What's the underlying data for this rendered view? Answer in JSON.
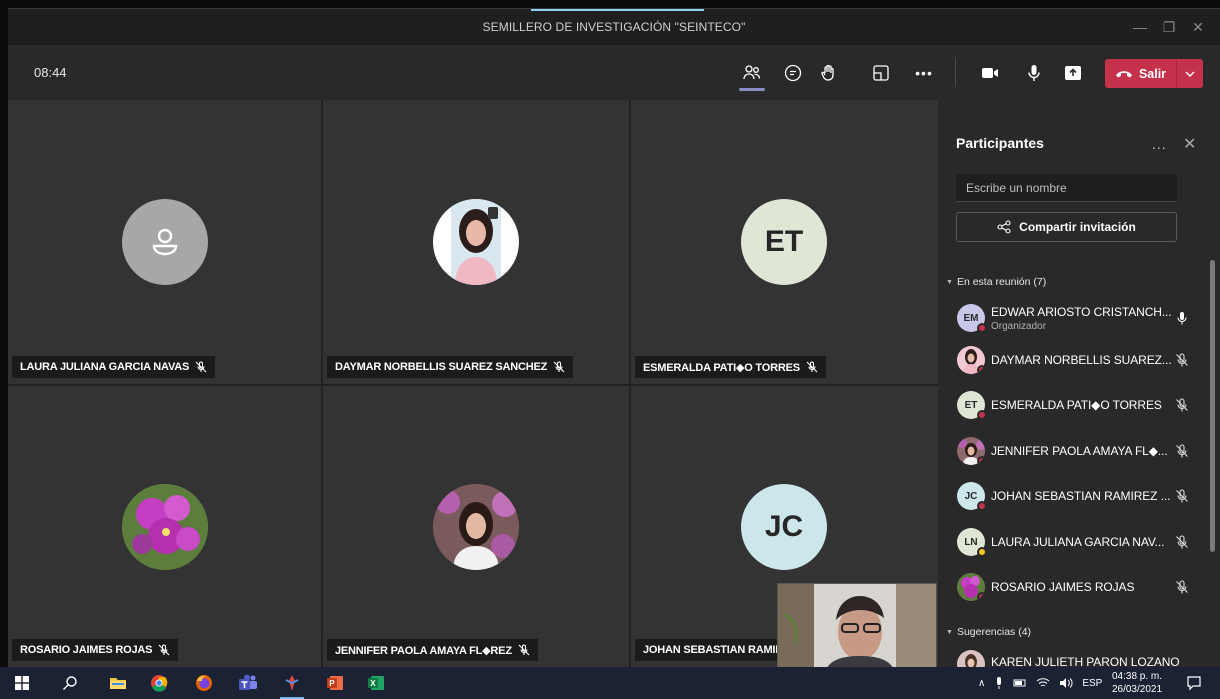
{
  "window": {
    "title": "SEMILLERO DE INVESTIGACIÓN \"SEINTECO\"",
    "minimize": "—",
    "maximize": "❐",
    "close": "✕"
  },
  "toolbar": {
    "timer": "08:44",
    "leave_label": "Salir"
  },
  "tiles": [
    {
      "name": "LAURA JULIANA GARCIA NAVAS",
      "avatar_type": "generic-person-icon",
      "avatar_color": "#a7a7a7"
    },
    {
      "name": "DAYMAR NORBELLIS SUAREZ SANCHEZ",
      "avatar_type": "photo",
      "avatar_color": "#f2d6dc"
    },
    {
      "name": "ESMERALDA PATI◆O TORRES",
      "avatar_type": "initials",
      "initials": "ET",
      "avatar_color": "#dfe6d5"
    },
    {
      "name": "ROSARIO JAIMES ROJAS",
      "avatar_type": "photo",
      "avatar_color": "#b23fb8"
    },
    {
      "name": "JENNIFER PAOLA AMAYA FL◆REZ",
      "avatar_type": "photo",
      "avatar_color": "#8c6a6d"
    },
    {
      "name": "JOHAN SEBASTIAN RAMIREZ",
      "avatar_type": "initials",
      "initials": "JC",
      "avatar_color": "#cde6ea"
    }
  ],
  "panel": {
    "title": "Participantes",
    "more": "...",
    "close": "✕",
    "search_placeholder": "Escribe un nombre",
    "share_label": "Compartir invitación",
    "section_in_meeting": "En esta reunión (7)",
    "section_suggestions": "Sugerencias (4)",
    "participants": [
      {
        "name": "EDWAR ARIOSTO CRISTANCH...",
        "role": "Organizador",
        "initials": "EM",
        "avatar_color": "#c9c7e8",
        "status_color": "#c4314b",
        "muted": false
      },
      {
        "name": "DAYMAR NORBELLIS SUAREZ...",
        "role": "",
        "initials": "",
        "avatar_color": "#f0c9d3",
        "status_color": "#c4314b",
        "muted": true
      },
      {
        "name": "ESMERALDA PATI◆O TORRES",
        "role": "",
        "initials": "ET",
        "avatar_color": "#dfe6d5",
        "status_color": "#c4314b",
        "muted": true
      },
      {
        "name": "JENNIFER PAOLA AMAYA FL◆...",
        "role": "",
        "initials": "",
        "avatar_color": "#8c6a6d",
        "status_color": "#c4314b",
        "muted": true
      },
      {
        "name": "JOHAN SEBASTIAN RAMIREZ ...",
        "role": "",
        "initials": "JC",
        "avatar_color": "#cde6ea",
        "status_color": "#c4314b",
        "muted": true
      },
      {
        "name": "LAURA JULIANA GARCIA NAV...",
        "role": "",
        "initials": "LN",
        "avatar_color": "#dfe6d5",
        "status_color": "#f8c51c",
        "muted": true
      },
      {
        "name": "ROSARIO JAIMES ROJAS",
        "role": "",
        "initials": "",
        "avatar_color": "#b23fb8",
        "status_color": "#c4314b",
        "muted": true
      }
    ],
    "suggestion_first": "KAREN JULIETH PARON LOZANO"
  },
  "taskbar": {
    "language": "ESP",
    "time": "04:38 p. m.",
    "date": "26/03/2021"
  }
}
